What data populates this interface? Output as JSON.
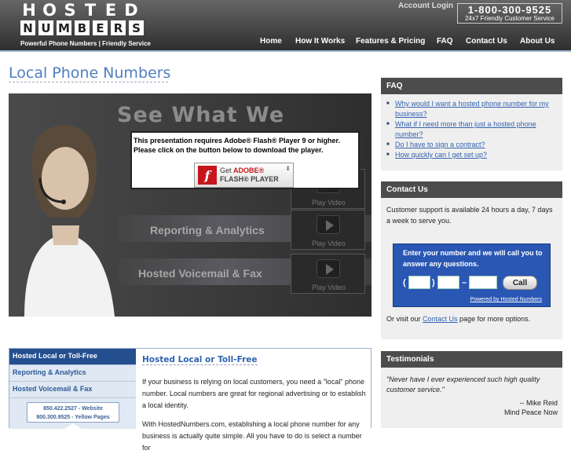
{
  "header": {
    "logo_row1": [
      "H",
      "O",
      "S",
      "T",
      "E",
      "D"
    ],
    "logo_row2": [
      "N",
      "U",
      "M",
      "B",
      "E",
      "R",
      "S"
    ],
    "tagline": "Powerful Phone Numbers  |  Friendly Service",
    "account_login": "Account Login",
    "phone": "1-800-300-9525",
    "phone_sub": "24x7 Friendly Customer Service"
  },
  "nav": [
    "Home",
    "How It Works",
    "Features & Pricing",
    "FAQ",
    "Contact Us",
    "About Us"
  ],
  "page_title": "Local Phone Numbers",
  "video": {
    "headline": "See What We",
    "bands": [
      "Reporting & Analytics",
      "Hosted Voicemail & Fax"
    ],
    "play_label": "Play Video",
    "flash_message_line1": "This presentation requires Adobe® Flash® Player 9 or higher.",
    "flash_message_line2": "Please click on the button below to download the player.",
    "flash_get": "Get",
    "flash_adobe": "ADOBE®",
    "flash_player": "FLASH® PLAYER",
    "flash_logo_letter": "f"
  },
  "lower": {
    "tabs": [
      "Hosted Local or Toll-Free",
      "Reporting & Analytics",
      "Hosted Voicemail & Fax"
    ],
    "promo_line1": "850.422.2527 - Website",
    "promo_line2": "800.300.9525 - Yellow Pages",
    "content_title": "Hosted Local or Toll-Free",
    "content_p1": "If your business is relying on local customers, you need a \"local\" phone number. Local numbers are great for regional advertising or to establish a local identity.",
    "content_p2": "With HostedNumbers.com, establishing a local phone number for any business is actually quite simple. All you have to do is select a number for"
  },
  "sidebar": {
    "faq_title": "FAQ",
    "faq_items": [
      "Why would I want a hosted phone number for my business?",
      "What if I need more than just a hosted phone number?",
      "Do I have to sign a contract?",
      "How quickly can I get set up?"
    ],
    "contact_title": "Contact Us",
    "contact_text": "Customer support is available 24 hours a day, 7 days a week to serve you.",
    "callbox_text": "Enter your number and we will call you to answer any questions.",
    "call_open_paren": "(",
    "call_close_paren": ")",
    "call_dash": "–",
    "call_button": "Call",
    "powered_by": "Powered by Hosted Numbers",
    "visit_prefix": "Or visit our ",
    "visit_link": "Contact Us",
    "visit_suffix": " page for more options.",
    "testimonials_title": "Testimonials",
    "testimonial_quote": "\"Never have I ever experienced such high quality customer service.\"",
    "testimonial_author": "-- Mike Reid",
    "testimonial_company": "Mind Peace Now"
  }
}
